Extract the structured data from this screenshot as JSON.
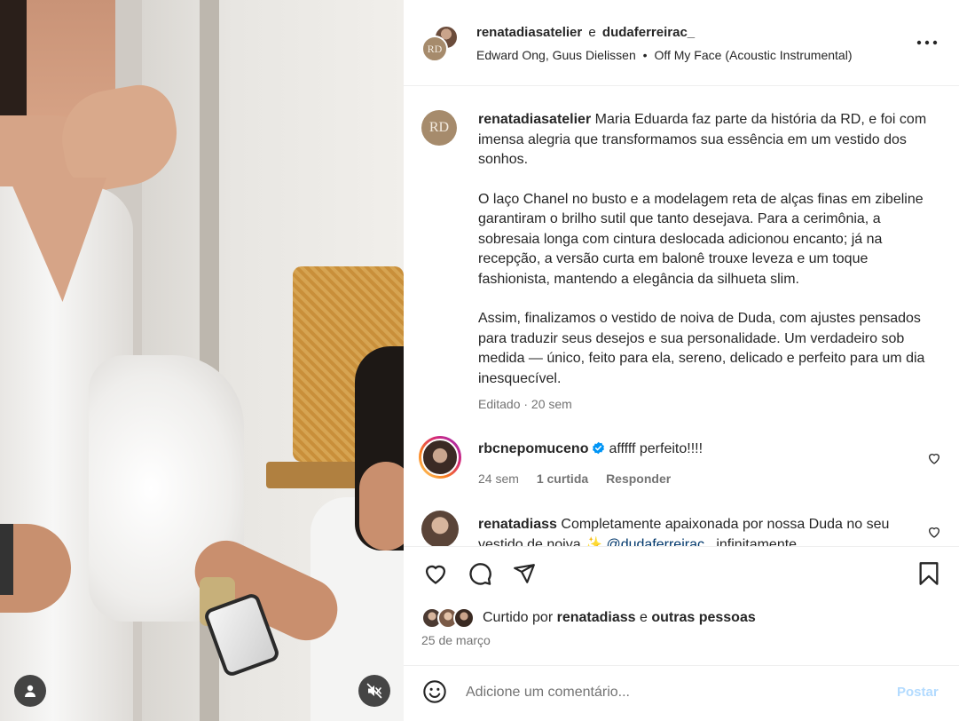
{
  "header": {
    "user1": "renatadiasatelier",
    "conjunction": "e",
    "user2": "dudaferreirac_",
    "music_artists": "Edward Ong, Guus Dielissen",
    "music_separator": "•",
    "music_track": "Off My Face (Acoustic Instrumental)",
    "avatar_initials": "RD"
  },
  "caption": {
    "avatar_initials": "RD",
    "username": "renatadiasatelier",
    "paragraph1": "Maria Eduarda faz parte da história da RD, e foi com imensa alegria que transformamos sua essência em um vestido dos sonhos.",
    "paragraph2": "O laço Chanel no busto e a modelagem reta de alças finas em zibeline garantiram o brilho sutil que tanto desejava. Para a cerimônia, a sobresaia longa com cintura deslocada adicionou encanto; já na recepção, a versão curta em balonê trouxe leveza e um toque fashionista, mantendo a elegância da silhueta slim.",
    "paragraph3": "Assim, finalizamos o vestido de noiva de Duda, com ajustes pensados para traduzir seus desejos e sua personalidade. Um verdadeiro sob medida — único, feito para ela, sereno, delicado e perfeito para um dia inesquecível.",
    "meta": "Editado · 20 sem"
  },
  "comments": [
    {
      "username": "rbcnepomuceno",
      "verified": true,
      "text": "afffff perfeito!!!!",
      "time": "24 sem",
      "likes": "1 curtida",
      "reply": "Responder"
    },
    {
      "username": "renatadiass",
      "text_before": "Completamente apaixonada por nossa Duda no seu vestido de noiva",
      "emoji": "✨",
      "mention": "@dudaferreirac_",
      "text_after": "infinitamente"
    }
  ],
  "likes": {
    "prefix": "Curtido por",
    "user": "renatadiass",
    "conjunction": "e",
    "others": "outras pessoas"
  },
  "post_date": "25 de março",
  "add_comment": {
    "placeholder": "Adicione um comentário...",
    "post_label": "Postar"
  },
  "icons": {
    "more": "more-horizontal-icon",
    "like": "heart-icon",
    "comment": "comment-icon",
    "share": "share-icon",
    "save": "bookmark-icon",
    "emoji": "emoji-icon",
    "user_tag": "user-icon",
    "mute": "mute-icon"
  },
  "colors": {
    "text": "#262626",
    "secondary": "#737373",
    "link": "#00376b",
    "post_button_disabled": "#b3dbff",
    "verified": "#0095f6"
  }
}
